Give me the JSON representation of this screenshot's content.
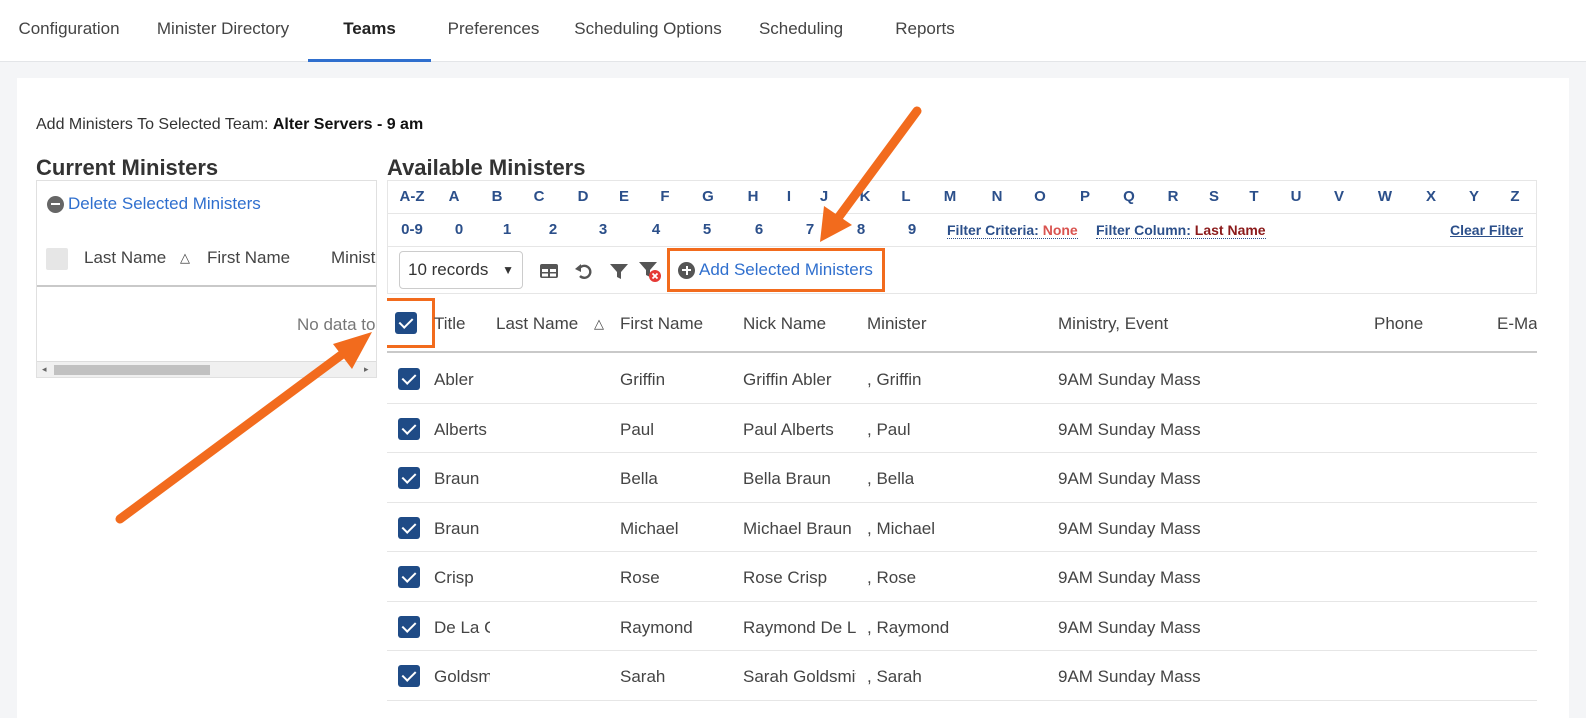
{
  "nav": {
    "tabs": [
      "Configuration",
      "Minister Directory",
      "Teams",
      "Preferences",
      "Scheduling Options",
      "Scheduling",
      "Reports"
    ],
    "active": "Teams"
  },
  "header": {
    "prefix": "Add Ministers To Selected Team:",
    "team": "Alter Servers - 9 am"
  },
  "current": {
    "title": "Current Ministers",
    "delete_label": "Delete Selected Ministers",
    "columns": [
      "Last Name",
      "First Name",
      "Minist"
    ],
    "no_data": "No data to"
  },
  "available": {
    "title": "Available Ministers",
    "alpha_row1": [
      "A-Z",
      "A",
      "B",
      "C",
      "D",
      "E",
      "F",
      "G",
      "H",
      "I",
      "J",
      "K",
      "L",
      "M",
      "N",
      "O",
      "P",
      "Q",
      "R",
      "S",
      "T",
      "U",
      "V",
      "W",
      "X",
      "Y",
      "Z"
    ],
    "alpha_row2": [
      "0-9",
      "0",
      "1",
      "2",
      "3",
      "4",
      "5",
      "6",
      "7",
      "8",
      "9"
    ],
    "filter_criteria_label": "Filter Criteria:",
    "filter_criteria_value": "None",
    "filter_column_label": "Filter Column:",
    "filter_column_value": "Last Name",
    "clear_filter": "Clear Filter",
    "records_select": "10 records",
    "add_label": "Add Selected Ministers",
    "columns": [
      "Title",
      "Last Name",
      "First Name",
      "Nick Name",
      "Minister",
      "Ministry, Event",
      "Phone",
      "E-Ma"
    ],
    "rows": [
      {
        "last": "Abler",
        "first": "Griffin",
        "nick": "Griffin Abler",
        "minister": ", Griffin",
        "event": "9AM Sunday Mass"
      },
      {
        "last": "Alberts",
        "first": "Paul",
        "nick": "Paul Alberts",
        "minister": ", Paul",
        "event": "9AM Sunday Mass"
      },
      {
        "last": "Braun",
        "first": "Bella",
        "nick": "Bella Braun",
        "minister": ", Bella",
        "event": "9AM Sunday Mass"
      },
      {
        "last": "Braun",
        "first": "Michael",
        "nick": "Michael Braun",
        "minister": ", Michael",
        "event": "9AM Sunday Mass"
      },
      {
        "last": "Crisp",
        "first": "Rose",
        "nick": "Rose Crisp",
        "minister": ", Rose",
        "event": "9AM Sunday Mass"
      },
      {
        "last": "De La Cruz",
        "first": "Raymond",
        "nick": "Raymond De La Cruz",
        "minister": ", Raymond",
        "event": "9AM Sunday Mass"
      },
      {
        "last": "Goldsmith",
        "first": "Sarah",
        "nick": "Sarah Goldsmith",
        "minister": ", Sarah",
        "event": "9AM Sunday Mass"
      }
    ]
  },
  "colors": {
    "accent": "#2f6fce",
    "highlight": "#f26b1d",
    "checkbox": "#1f4b86"
  }
}
